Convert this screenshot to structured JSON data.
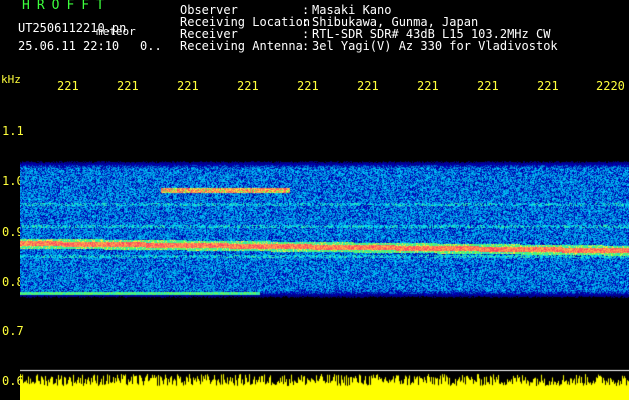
{
  "header": {
    "logo": "HROFFT",
    "filename": "UT2506112210.pn",
    "filename_suffix": "meteor",
    "datetime": "25.06.11 22:10",
    "datetime_extra": "0..",
    "fields": [
      {
        "label": "Observer",
        "sep": ":",
        "value": "Masaki Kano"
      },
      {
        "label": "Receiving Location",
        "sep": ":",
        "value": "Shibukawa, Gunma, Japan"
      },
      {
        "label": "Receiver",
        "sep": ":",
        "value": "RTL-SDR SDR# 43dB L15 103.2MHz CW"
      },
      {
        "label": "Receiving Antenna",
        "sep": ":",
        "value": "3el Yagi(V) Az 330 for Vladivostok"
      }
    ]
  },
  "axes": {
    "y_unit": "kHz",
    "y_ticks": [
      "1.1",
      "1.0",
      "0.9",
      "0.8",
      "0.7",
      "0.6"
    ],
    "x_ticks": [
      "221",
      "221",
      "221",
      "221",
      "221",
      "221",
      "221",
      "221",
      "221",
      "2220"
    ]
  },
  "colors": {
    "label_green": "#3cff3c",
    "tick_yellow": "#ffff3c",
    "background": "#000000",
    "spectrum_base": "#0a0a8c",
    "signal_red": "#ff2a5a",
    "echo_yellow": "#ffff00"
  }
}
